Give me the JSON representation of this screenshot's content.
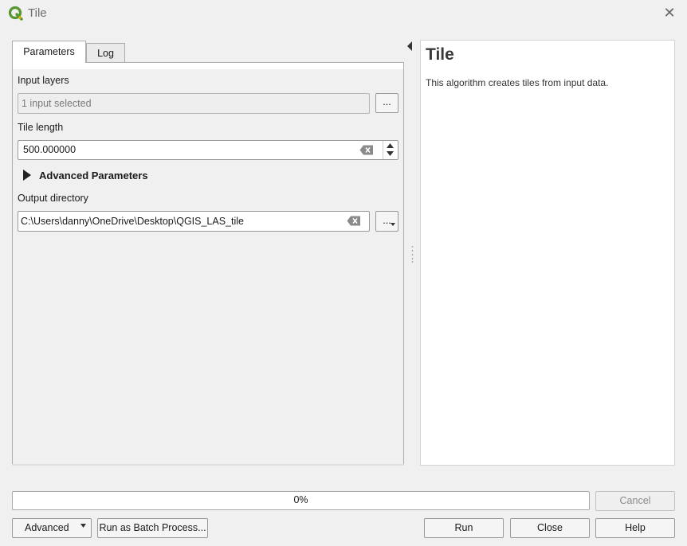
{
  "window": {
    "title": "Tile",
    "close_label": "✕"
  },
  "tabs": [
    {
      "label": "Parameters",
      "selected": true
    },
    {
      "label": "Log",
      "selected": false
    }
  ],
  "params": {
    "input_layers": {
      "label": "Input layers",
      "value": "1 input selected",
      "browse_label": "..."
    },
    "tile_length": {
      "label": "Tile length",
      "value": "500.000000"
    },
    "advanced": {
      "label": "Advanced Parameters",
      "expanded": false
    },
    "output_dir": {
      "label": "Output directory",
      "value": "C:\\Users\\danny\\OneDrive\\Desktop\\QGIS_LAS_tile",
      "browse_label": "..."
    }
  },
  "help": {
    "title": "Tile",
    "description": "This algorithm creates tiles from input data."
  },
  "progress": {
    "percent": 0,
    "label": "0%"
  },
  "buttons": {
    "cancel": "Cancel",
    "advanced": "Advanced",
    "batch": "Run as Batch Process...",
    "run": "Run",
    "close": "Close",
    "help": "Help"
  },
  "colors": {
    "qgis_green": "#589632",
    "qgis_yellow": "#ee7913"
  }
}
